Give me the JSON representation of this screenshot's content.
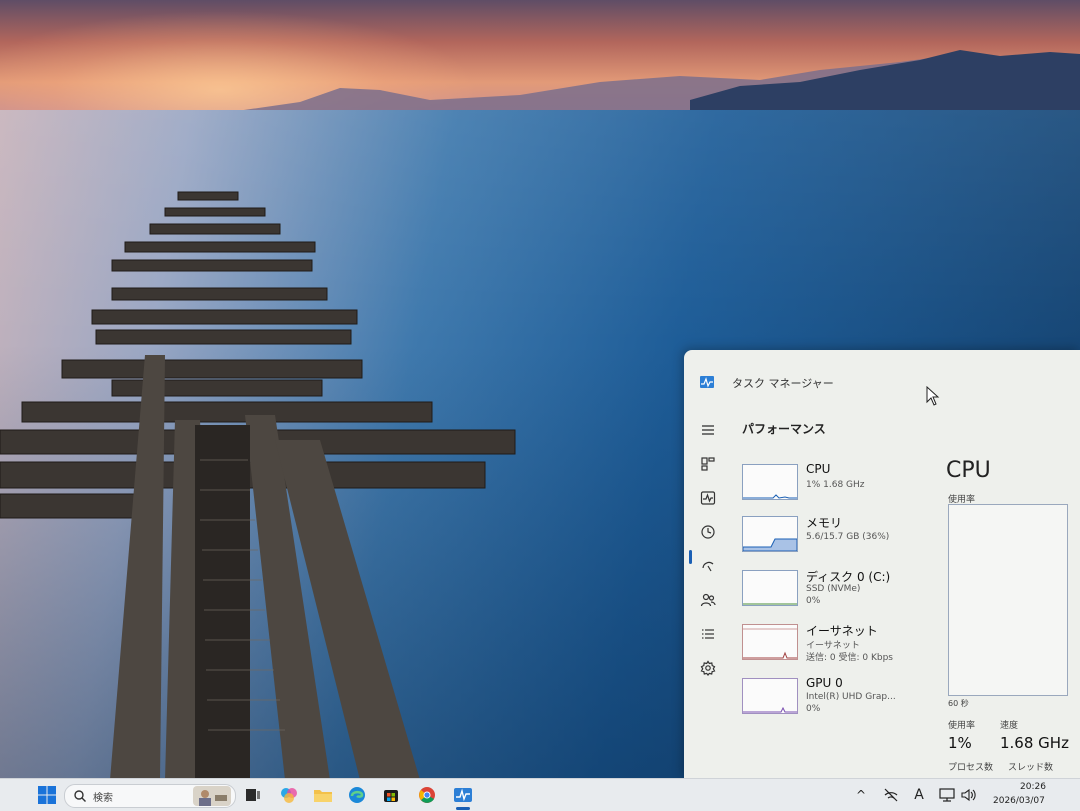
{
  "window": {
    "title": "タスク マネージャー"
  },
  "page_title": "パフォーマンス",
  "nav_icons": [
    "menu-icon",
    "processes-icon",
    "performance-icon",
    "app-history-icon",
    "startup-apps-icon",
    "users-icon",
    "details-icon",
    "services-icon"
  ],
  "performance_items": [
    {
      "name": "CPU",
      "sub1": "1%  1.68 GHz",
      "sub2": ""
    },
    {
      "name": "メモリ",
      "sub1": "5.6/15.7 GB (36%)",
      "sub2": ""
    },
    {
      "name": "ディスク 0 (C:)",
      "sub1": "SSD (NVMe)",
      "sub2": "0%"
    },
    {
      "name": "イーサネット",
      "sub1": "イーサネット",
      "sub2": "送信: 0 受信: 0 Kbps"
    },
    {
      "name": "GPU 0",
      "sub1": "Intel(R) UHD Grap...",
      "sub2": "0%"
    }
  ],
  "cpu_detail": {
    "title": "CPU",
    "usage_label": "使用率",
    "graph_time": "60 秒",
    "usage_stat_label": "使用率",
    "usage_value": "1%",
    "speed_label": "速度",
    "speed_value": "1.68 GHz",
    "process_label": "プロセス数",
    "thread_label": "スレッド数"
  },
  "taskbar": {
    "search_placeholder": "検索",
    "clock_time": "20:26",
    "clock_date": "2026/03/07",
    "ime_label": "A",
    "tray_chevron": "^"
  },
  "colors": {
    "accent": "#1a5fb4",
    "taskbar_bg": "#e8ebee",
    "panel_bg": "#eef0ec"
  }
}
